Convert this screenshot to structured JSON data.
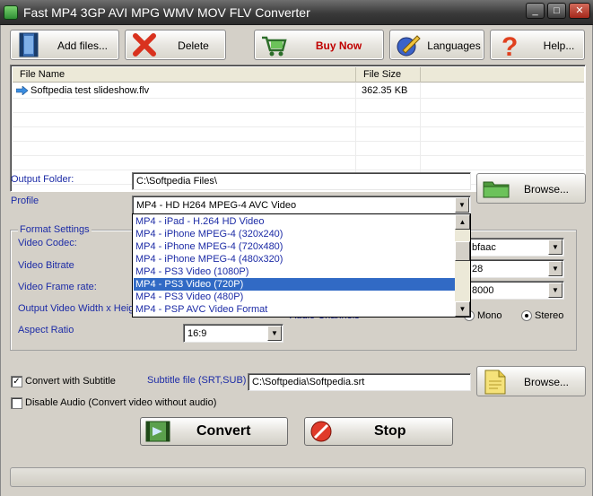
{
  "window": {
    "title": "Fast MP4 3GP AVI MPG WMV MOV FLV Converter",
    "minimize": "_",
    "maximize": "□",
    "close": "✕"
  },
  "toolbar": {
    "add_files": "Add files...",
    "delete": "Delete",
    "buy_now": "Buy Now",
    "languages": "Languages",
    "help": "Help..."
  },
  "file_list": {
    "columns": [
      "File Name",
      "File Size"
    ],
    "rows": [
      {
        "name": "Softpedia test slideshow.flv",
        "size": "362.35 KB"
      }
    ]
  },
  "output": {
    "label": "Output Folder:",
    "value": "C:\\Softpedia Files\\",
    "browse": "Browse..."
  },
  "profile": {
    "label": "Profile",
    "value": "MP4 - HD H264 MPEG-4 AVC Video",
    "options": [
      "MP4 - iPad - H.264 HD Video",
      "MP4 - iPhone MPEG-4 (320x240)",
      "MP4 - iPhone MPEG-4 (720x480)",
      "MP4 - iPhone MPEG-4 (480x320)",
      "MP4 - PS3 Video (1080P)",
      "MP4 - PS3 Video (720P)",
      "MP4 - PS3 Video (480P)",
      "MP4 - PSP AVC Video Format"
    ],
    "selected_index": 5
  },
  "format_settings": {
    "legend": "Format Settings",
    "video_codec": "Video Codec:",
    "video_bitrate": "Video Bitrate",
    "video_frame_rate": "Video Frame rate:",
    "output_size": "Output Video Width x Height",
    "aspect_ratio": "Aspect Ratio",
    "aspect_value": "16:9",
    "audio_codec_partial": "bfaac",
    "audio_bitrate_partial": "28",
    "audio_rate_partial": "8000",
    "audio_channels": "Audio Channels",
    "mono": "Mono",
    "stereo": "Stereo"
  },
  "subtitle": {
    "checkbox_label": "Convert with Subtitle",
    "checked": true,
    "file_label": "Subtitle file (SRT,SUB)",
    "value": "C:\\Softpedia\\Softpedia.srt",
    "browse": "Browse..."
  },
  "disable_audio": {
    "label": "Disable Audio (Convert video without audio)",
    "checked": false
  },
  "actions": {
    "convert": "Convert",
    "stop": "Stop"
  },
  "colors": {
    "label_blue": "#1c2ba6",
    "buy_now_red": "#c00000",
    "selection": "#316ac5"
  }
}
